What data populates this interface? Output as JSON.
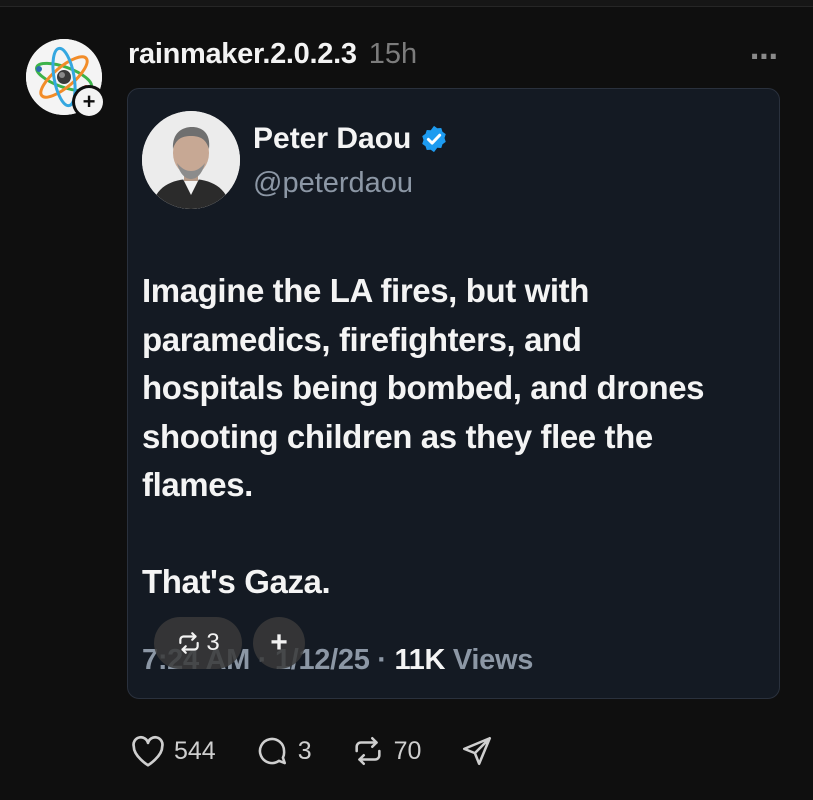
{
  "post": {
    "username": "rainmaker.2.0.2.3",
    "time": "15h",
    "more_icon": "⋯",
    "follow_icon": "+"
  },
  "embed": {
    "display_name": "Peter Daou",
    "handle": "@peterdaou",
    "body": [
      "Imagine the LA fires, but with",
      "paramedics, firefighters, and",
      "hospitals being bombed, and drones",
      "shooting children as they flee the",
      "flames."
    ],
    "body_final": "That's Gaza.",
    "timestamp": "7:24 AM · 1/12/25 · ",
    "views_count": "11K",
    "views_label": " Views",
    "overlay_repost_count": "3",
    "overlay_add_icon": "+"
  },
  "actions": {
    "likes": "544",
    "replies": "3",
    "reposts": "70"
  },
  "colors": {
    "background": "#0f0f0f",
    "card": "#141a23",
    "muted": "#8c97a5",
    "verified": "#1d9bf0"
  },
  "icons": [
    "heart-icon",
    "reply-icon",
    "repost-icon",
    "share-icon",
    "verified-icon",
    "more-icon"
  ]
}
